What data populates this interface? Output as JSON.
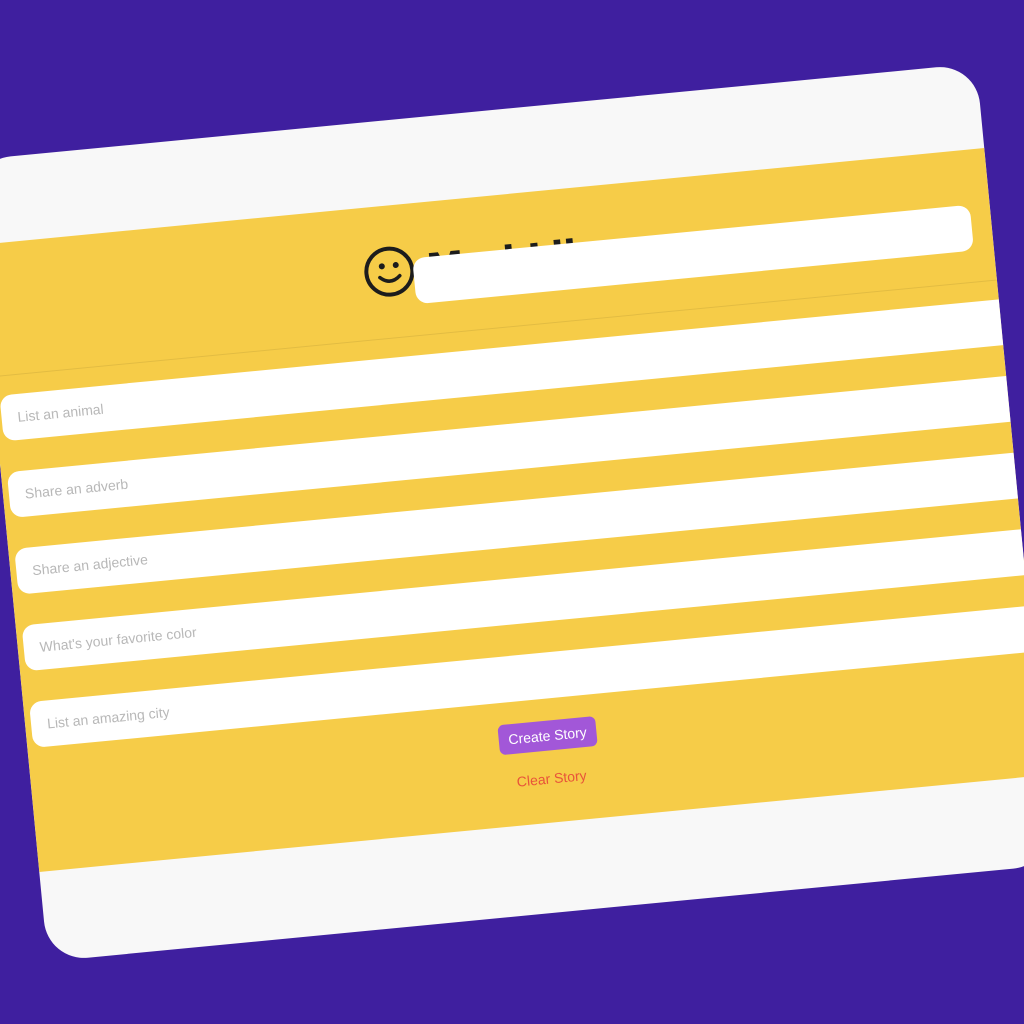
{
  "app": {
    "title": "Mad Libs",
    "icon": "smiley-face-icon"
  },
  "form": {
    "fields": [
      {
        "name": "blank-field",
        "value": "",
        "placeholder": ""
      },
      {
        "name": "animal-input",
        "value": "",
        "placeholder": "List an animal"
      },
      {
        "name": "adverb-input",
        "value": "",
        "placeholder": "Share an adverb"
      },
      {
        "name": "adjective-input",
        "value": "",
        "placeholder": "Share an adjective"
      },
      {
        "name": "color-input",
        "value": "",
        "placeholder": "What's your favorite color"
      },
      {
        "name": "city-input",
        "value": "",
        "placeholder": "List an amazing city"
      }
    ],
    "create_label": "Create Story",
    "clear_label": "Clear Story"
  },
  "colors": {
    "background": "#3f1f9f",
    "panel": "#f6cc48",
    "create_button": "#a257d8",
    "clear_text": "#e8543a"
  }
}
